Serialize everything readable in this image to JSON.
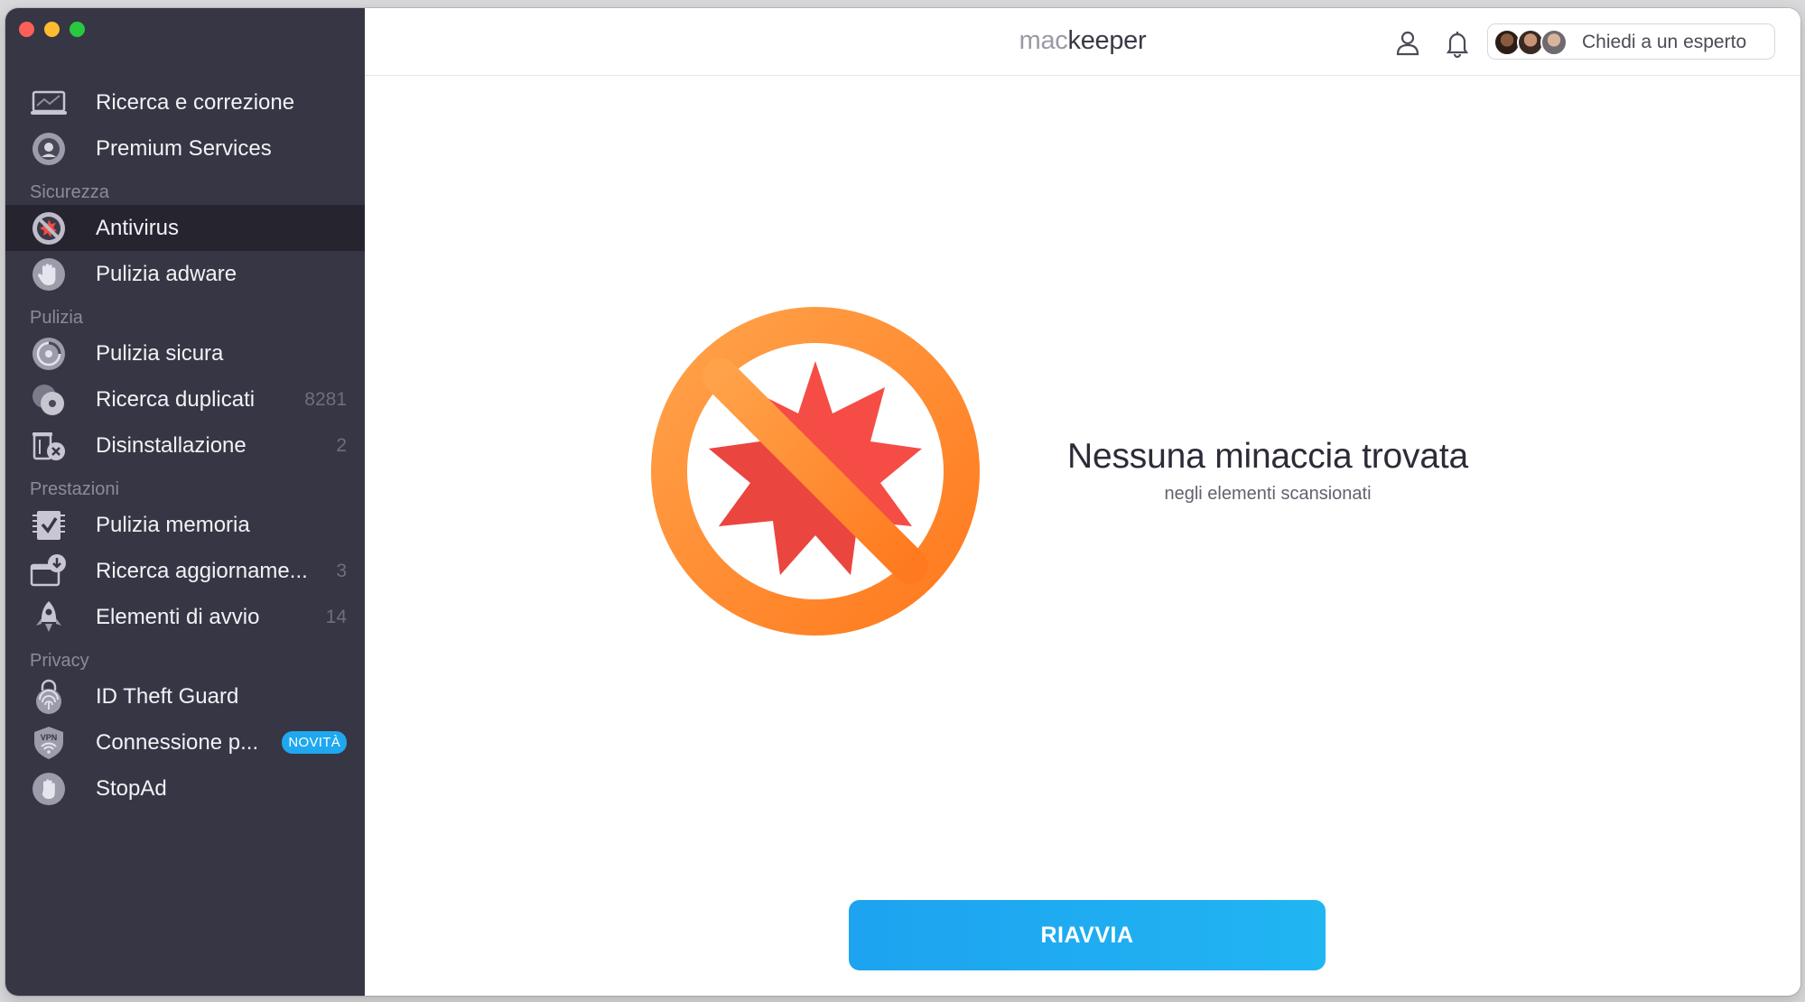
{
  "app": {
    "brand_light": "mac",
    "brand_bold": "keeper"
  },
  "header": {
    "expert_label": "Chiedi a un esperto"
  },
  "sidebar": {
    "items_top": [
      {
        "label": "Ricerca e correzione",
        "icon": "laptop-scan-icon"
      },
      {
        "label": "Premium Services",
        "icon": "headset-icon"
      }
    ],
    "sections": [
      {
        "title": "Sicurezza",
        "items": [
          {
            "label": "Antivirus",
            "icon": "antivirus-icon",
            "active": true
          },
          {
            "label": "Pulizia adware",
            "icon": "hand-stop-icon"
          }
        ]
      },
      {
        "title": "Pulizia",
        "items": [
          {
            "label": "Pulizia sicura",
            "icon": "disk-clean-icon"
          },
          {
            "label": "Ricerca duplicati",
            "icon": "duplicates-icon",
            "count": "8281"
          },
          {
            "label": "Disinstallazione",
            "icon": "uninstall-icon",
            "count": "2"
          }
        ]
      },
      {
        "title": "Prestazioni",
        "items": [
          {
            "label": "Pulizia memoria",
            "icon": "memory-check-icon"
          },
          {
            "label": "Ricerca aggiorname...",
            "icon": "update-download-icon",
            "count": "3"
          },
          {
            "label": "Elementi di avvio",
            "icon": "rocket-icon",
            "count": "14"
          }
        ]
      },
      {
        "title": "Privacy",
        "items": [
          {
            "label": "ID Theft Guard",
            "icon": "fingerprint-lock-icon"
          },
          {
            "label": "Connessione p...",
            "icon": "vpn-shield-icon",
            "badge": "NOVITÀ"
          },
          {
            "label": "StopAd",
            "icon": "stop-hand-icon"
          }
        ]
      }
    ]
  },
  "main": {
    "status_title": "Nessuna minaccia trovata",
    "status_subtitle": "negli elementi scansionati",
    "restart_label": "RIAVVIA"
  },
  "colors": {
    "sidebar_bg": "#373645",
    "sidebar_active": "#25242f",
    "accent_blue": "#1da3f0",
    "badge_blue": "#1fa8ef",
    "warning_orange": "#ff8a2a",
    "threat_red": "#f24b45"
  }
}
